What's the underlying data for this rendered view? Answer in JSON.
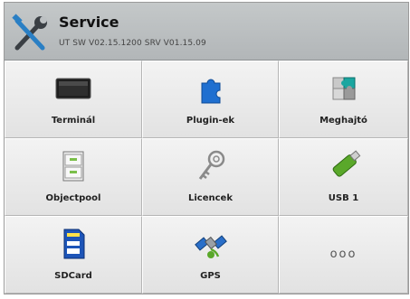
{
  "header": {
    "title": "Service",
    "version": "UT SW V02.15.1200 SRV V01.15.09",
    "icon": "tools-icon"
  },
  "tiles": [
    {
      "label": "Terminál",
      "icon": "monitor-icon"
    },
    {
      "label": "Plugin-ek",
      "icon": "puzzle-piece-icon"
    },
    {
      "label": "Meghajtó",
      "icon": "puzzle-drivers-icon"
    },
    {
      "label": "Objectpool",
      "icon": "file-cabinet-icon"
    },
    {
      "label": "Licencek",
      "icon": "key-icon"
    },
    {
      "label": "USB 1",
      "icon": "usb-stick-icon"
    },
    {
      "label": "SDCard",
      "icon": "sd-card-icon"
    },
    {
      "label": "GPS",
      "icon": "satellite-icon"
    },
    {
      "label": "",
      "icon": "more-icon",
      "symbol": "ooo"
    }
  ]
}
